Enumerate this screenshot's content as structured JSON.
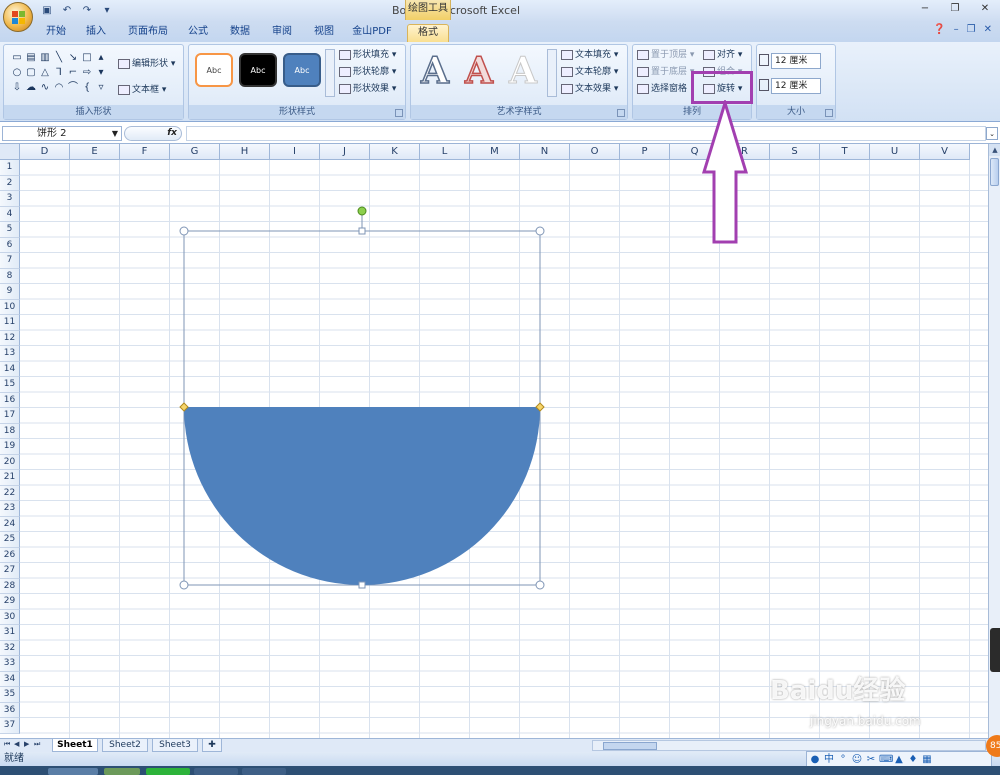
{
  "window": {
    "title": "Book1 - Microsoft Excel",
    "context_tools_label": "绘图工具"
  },
  "qat": {
    "icons": [
      "save-icon",
      "undo-icon",
      "redo-icon",
      "customize-icon"
    ]
  },
  "tabs": [
    {
      "label": "开始"
    },
    {
      "label": "插入"
    },
    {
      "label": "页面布局"
    },
    {
      "label": "公式"
    },
    {
      "label": "数据"
    },
    {
      "label": "审阅"
    },
    {
      "label": "视图"
    },
    {
      "label": "金山PDF"
    },
    {
      "label": "格式",
      "active": true
    }
  ],
  "ribbon": {
    "insert_shapes": {
      "label": "插入形状",
      "edit_shape": "编辑形状",
      "textbox": "文本框"
    },
    "shape_styles": {
      "label": "形状样式",
      "fill": "形状填充",
      "outline": "形状轮廓",
      "effects": "形状效果",
      "swatch_text": "Abc"
    },
    "wordart": {
      "label": "艺术字样式",
      "glyph": "A",
      "fill": "文本填充",
      "outline": "文本轮廓",
      "effects": "文本效果"
    },
    "arrange": {
      "label": "排列",
      "bring_front": "置于顶层",
      "send_back": "置于底层",
      "selection_pane": "选择窗格",
      "align": "对齐",
      "group": "组合",
      "rotate": "旋转"
    },
    "size": {
      "label": "大小",
      "height": "12 厘米",
      "width": "12 厘米"
    }
  },
  "formula_bar": {
    "name_box": "饼形 2",
    "fx": "fx"
  },
  "columns": [
    "D",
    "E",
    "F",
    "G",
    "H",
    "I",
    "J",
    "K",
    "L",
    "M",
    "N",
    "O",
    "P",
    "Q",
    "R",
    "S",
    "T",
    "U",
    "V"
  ],
  "rows": [
    "1",
    "2",
    "3",
    "4",
    "5",
    "6",
    "7",
    "8",
    "9",
    "10",
    "11",
    "12",
    "13",
    "14",
    "15",
    "16",
    "17",
    "18",
    "19",
    "20",
    "21",
    "22",
    "23",
    "24",
    "25",
    "26",
    "27",
    "28",
    "29",
    "30",
    "31",
    "32",
    "33",
    "34",
    "35",
    "36",
    "37"
  ],
  "sheets": {
    "tabs": [
      "Sheet1",
      "Sheet2",
      "Sheet3"
    ],
    "active": "Sheet1"
  },
  "status": {
    "text": "就绪"
  },
  "shape": {
    "name": "饼形 2",
    "fill_color": "#4f81bd"
  },
  "annotation": {
    "highlight_color": "#a23fb0"
  },
  "ime": {
    "label": "中"
  },
  "badge": {
    "text": "85"
  },
  "watermark": {
    "text": "Baidu经验",
    "sub": "jingyan.baidu.com"
  }
}
